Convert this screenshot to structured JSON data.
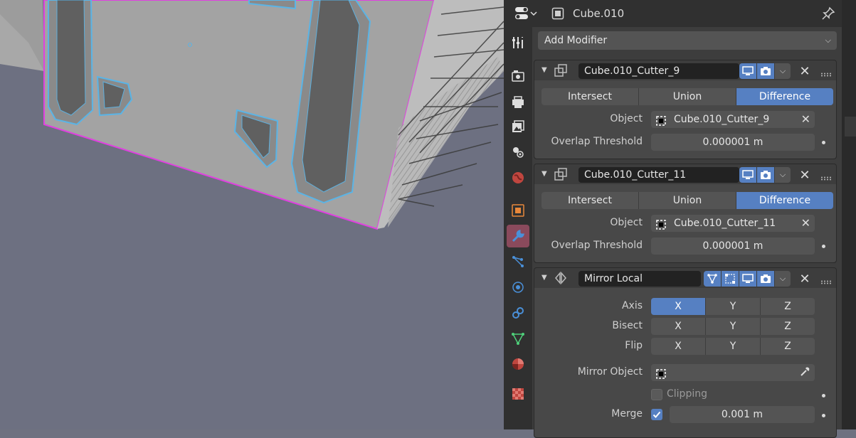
{
  "header": {
    "object_name": "Cube.010"
  },
  "toolbar": {
    "add_modifier_label": "Add Modifier"
  },
  "property_tabs": [
    {
      "name": "tool",
      "icon": "tool-icon"
    },
    {
      "name": "render",
      "icon": "render-icon"
    },
    {
      "name": "output",
      "icon": "output-icon"
    },
    {
      "name": "view-layer",
      "icon": "view-layer-icon"
    },
    {
      "name": "scene",
      "icon": "scene-icon"
    },
    {
      "name": "world",
      "icon": "world-icon"
    },
    {
      "name": "object",
      "icon": "object-icon"
    },
    {
      "name": "modifiers",
      "icon": "wrench-icon",
      "active": true
    },
    {
      "name": "particles",
      "icon": "particles-icon"
    },
    {
      "name": "physics",
      "icon": "physics-icon"
    },
    {
      "name": "constraints",
      "icon": "constraints-icon"
    },
    {
      "name": "data",
      "icon": "mesh-data-icon"
    },
    {
      "name": "material",
      "icon": "material-icon"
    },
    {
      "name": "texture",
      "icon": "texture-icon"
    }
  ],
  "modifiers": [
    {
      "name": "Cube.010_Cutter_9",
      "operations": [
        "Intersect",
        "Union",
        "Difference"
      ],
      "selected_operation": "Difference",
      "object_label": "Object",
      "object_value": "Cube.010_Cutter_9",
      "overlap_label": "Overlap Threshold",
      "overlap_value": "0.000001 m"
    },
    {
      "name": "Cube.010_Cutter_11",
      "operations": [
        "Intersect",
        "Union",
        "Difference"
      ],
      "selected_operation": "Difference",
      "object_label": "Object",
      "object_value": "Cube.010_Cutter_11",
      "overlap_label": "Overlap Threshold",
      "overlap_value": "0.000001 m"
    },
    {
      "name": "Mirror Local",
      "axis_label": "Axis",
      "axis_options": [
        "X",
        "Y",
        "Z"
      ],
      "axis_selected": "X",
      "bisect_label": "Bisect",
      "bisect_options": [
        "X",
        "Y",
        "Z"
      ],
      "flip_label": "Flip",
      "flip_options": [
        "X",
        "Y",
        "Z"
      ],
      "mirror_object_label": "Mirror Object",
      "mirror_object_value": "",
      "clipping_label": "Clipping",
      "clipping_checked": false,
      "merge_label": "Merge",
      "merge_checked": true,
      "merge_value": "0.001 m"
    }
  ],
  "colors": {
    "accent": "#5680c2",
    "selection_outline": "#e040e0",
    "cutter_outline": "#5ab4e6",
    "active_tab": "#8a4a5c"
  }
}
